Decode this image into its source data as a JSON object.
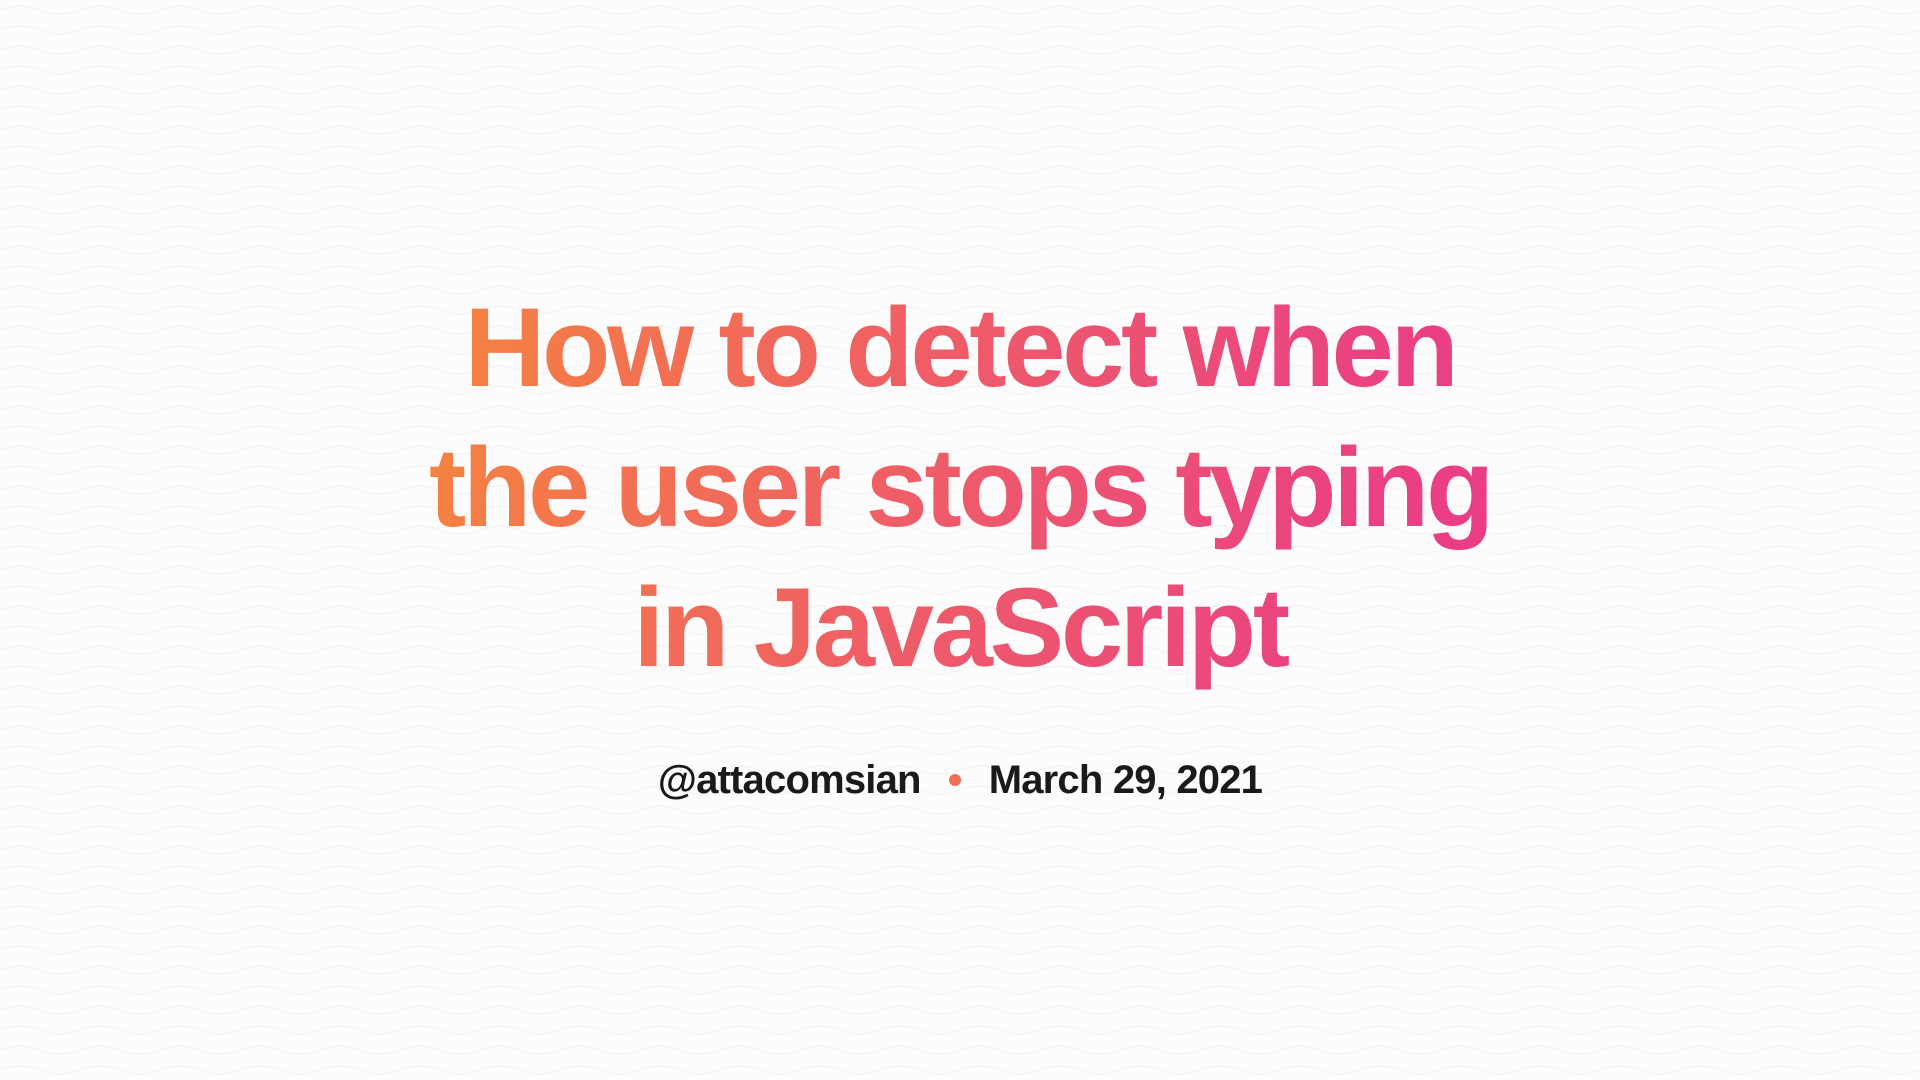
{
  "article": {
    "title": "How to detect when the user stops typing in JavaScript",
    "author_handle": "@attacomsian",
    "publish_date": "March 29, 2021"
  },
  "theme": {
    "gradient_start": "#f5883b",
    "gradient_end": "#e93a88",
    "separator_color": "#f26d52",
    "text_color": "#1a1a1a",
    "bg_color": "#fdfcfc"
  }
}
